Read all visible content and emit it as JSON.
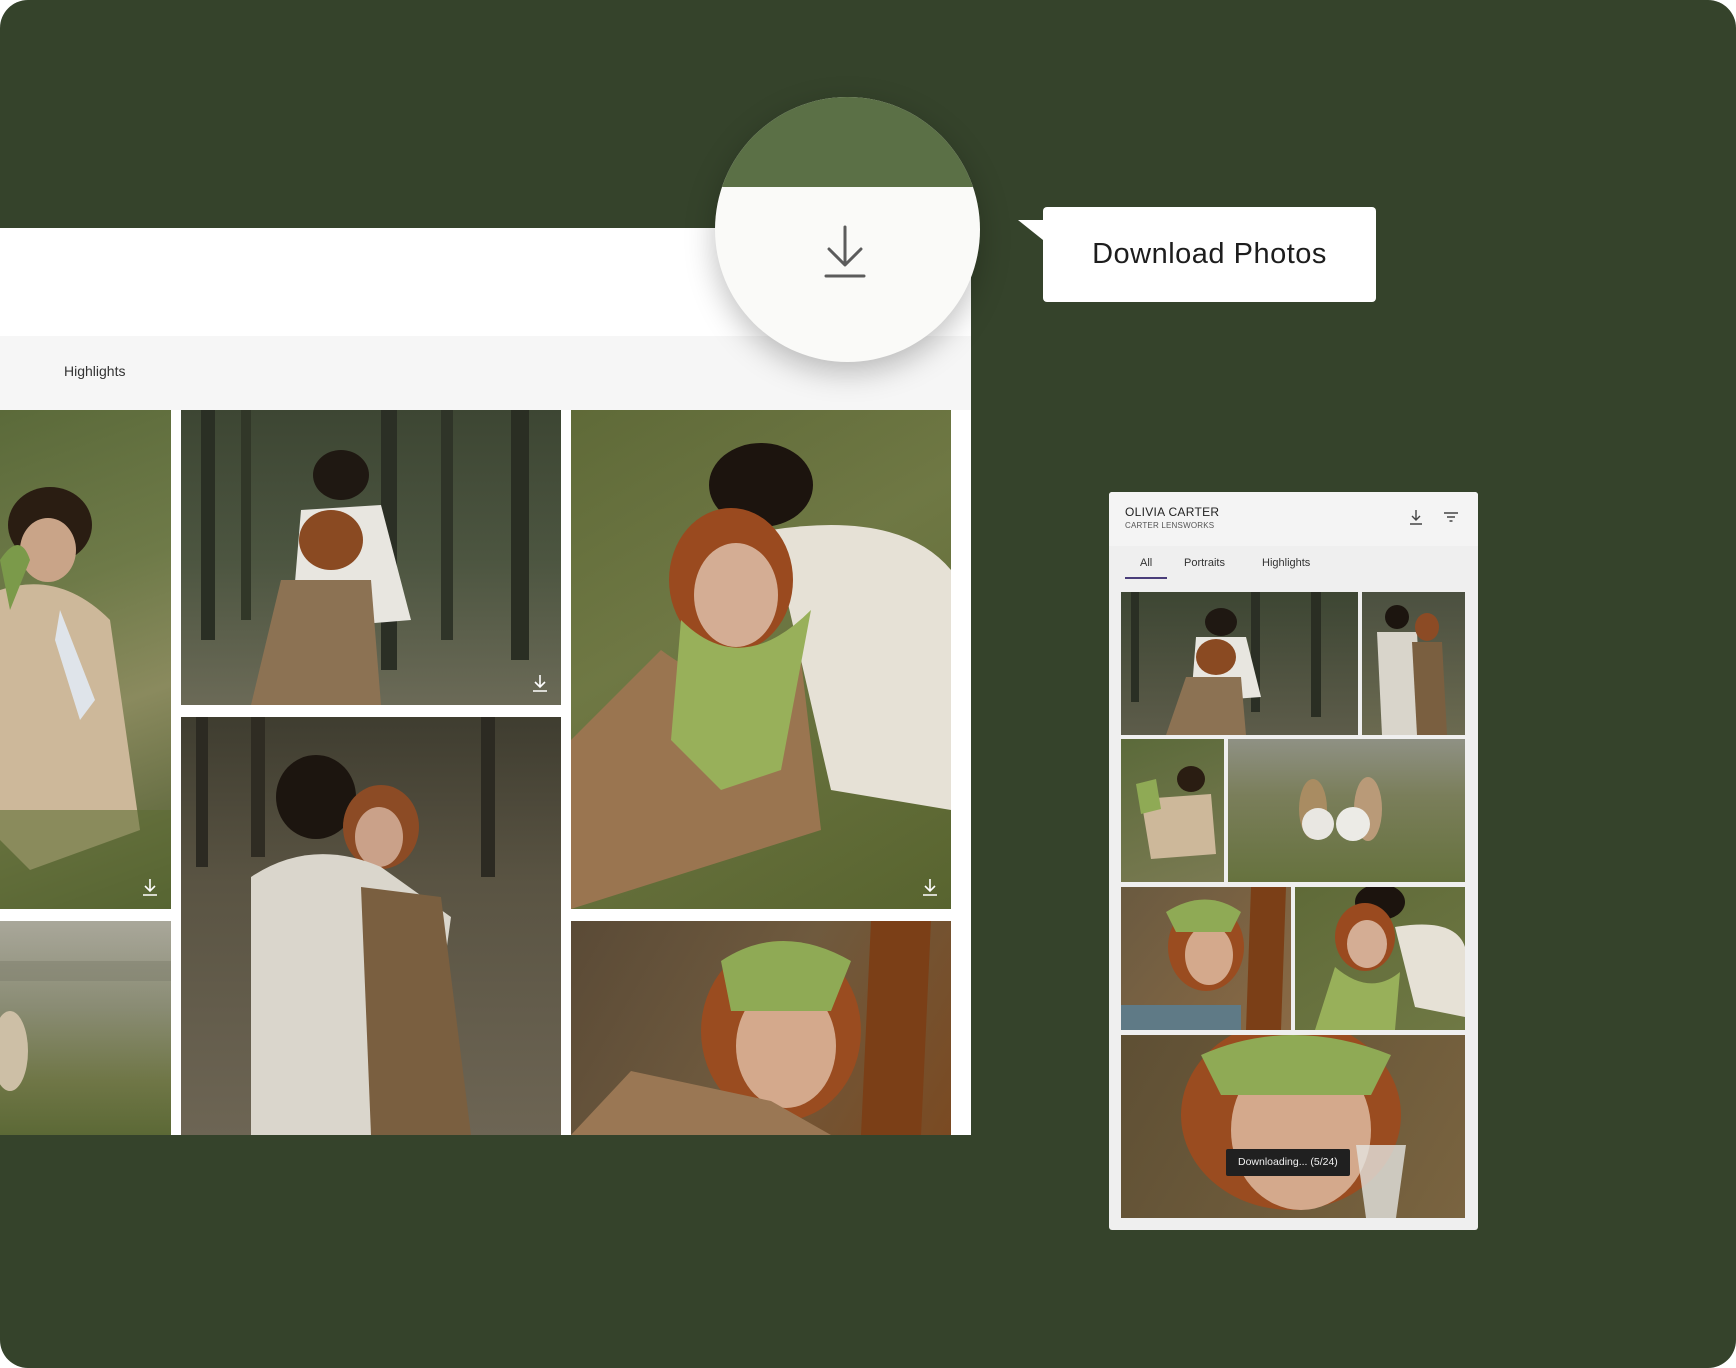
{
  "colors": {
    "background": "#35432b",
    "accent_green": "#5b7046",
    "tab_underline": "#4a3e7a"
  },
  "desktop": {
    "tab_label": "Highlights",
    "tile_icon": "download-icon"
  },
  "magnifier": {
    "icon": "download-icon"
  },
  "callout": {
    "text": "Download Photos"
  },
  "mobile": {
    "owner_name": "OLIVIA CARTER",
    "studio_name": "CARTER LENSWORKS",
    "icons": [
      "download-icon",
      "filter-icon"
    ],
    "tabs": [
      {
        "label": "All",
        "active": true
      },
      {
        "label": "Portraits",
        "active": false
      },
      {
        "label": "Highlights",
        "active": false
      }
    ],
    "toast": "Downloading...  (5/24)"
  }
}
